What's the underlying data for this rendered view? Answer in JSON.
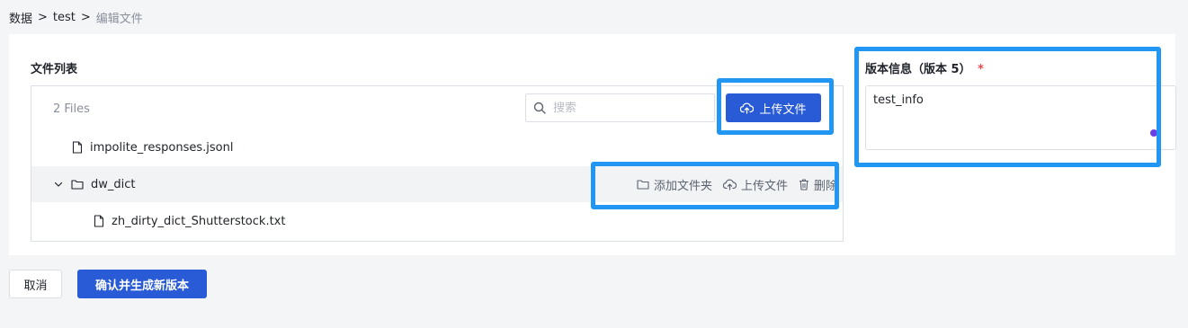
{
  "breadcrumb": {
    "items": [
      "数据",
      "test",
      "编辑文件"
    ],
    "separator": ">"
  },
  "file_list": {
    "title": "文件列表",
    "count_label": "2 Files",
    "search_placeholder": "搜索",
    "upload_button": "上传文件",
    "files": [
      {
        "name": "impolite_responses.jsonl",
        "type": "file",
        "depth": 0
      },
      {
        "name": "dw_dict",
        "type": "folder",
        "depth": 0,
        "expanded": true
      },
      {
        "name": "zh_dirty_dict_Shutterstock.txt",
        "type": "file",
        "depth": 1
      }
    ],
    "row_actions": {
      "add_folder": "添加文件夹",
      "upload": "上传文件",
      "delete": "删除"
    }
  },
  "version_info": {
    "label": "版本信息（版本 5）",
    "required_mark": "*",
    "value": "test_info"
  },
  "footer": {
    "cancel": "取消",
    "confirm": "确认并生成新版本"
  },
  "colors": {
    "primary": "#2a5bd7",
    "highlight": "#2196f3",
    "required": "#e5484d"
  }
}
